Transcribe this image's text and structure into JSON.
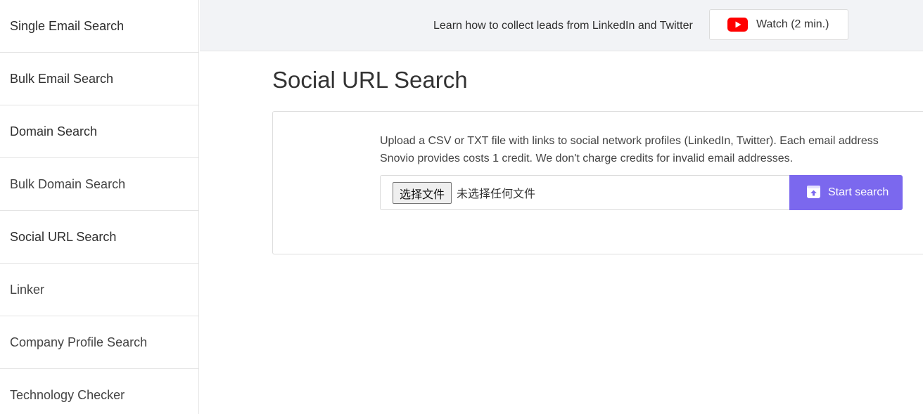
{
  "sidebar": {
    "items": [
      {
        "label": "Single Email Search"
      },
      {
        "label": "Bulk Email Search"
      },
      {
        "label": "Domain Search"
      },
      {
        "label": "Bulk Domain Search"
      },
      {
        "label": "Social URL Search"
      },
      {
        "label": "Linker"
      },
      {
        "label": "Company Profile Search"
      },
      {
        "label": "Technology Checker"
      }
    ]
  },
  "banner": {
    "text": "Learn how to collect leads from LinkedIn and Twitter",
    "watch_label": "Watch (2 min.)",
    "watch_icon": "youtube-icon"
  },
  "main": {
    "title": "Social URL Search",
    "description": "Upload a CSV or TXT file with links to social network profiles (LinkedIn, Twitter). Each email address Snovio provides costs 1 credit. We don't charge credits for invalid email addresses.",
    "file_input": {
      "button_label": "选择文件",
      "status": "未选择任何文件"
    },
    "start_button": {
      "label": "Start search",
      "icon": "upload-icon"
    }
  },
  "colors": {
    "accent": "#7b68ee",
    "banner_bg": "#f2f3f6",
    "youtube_red": "#ff0000"
  }
}
